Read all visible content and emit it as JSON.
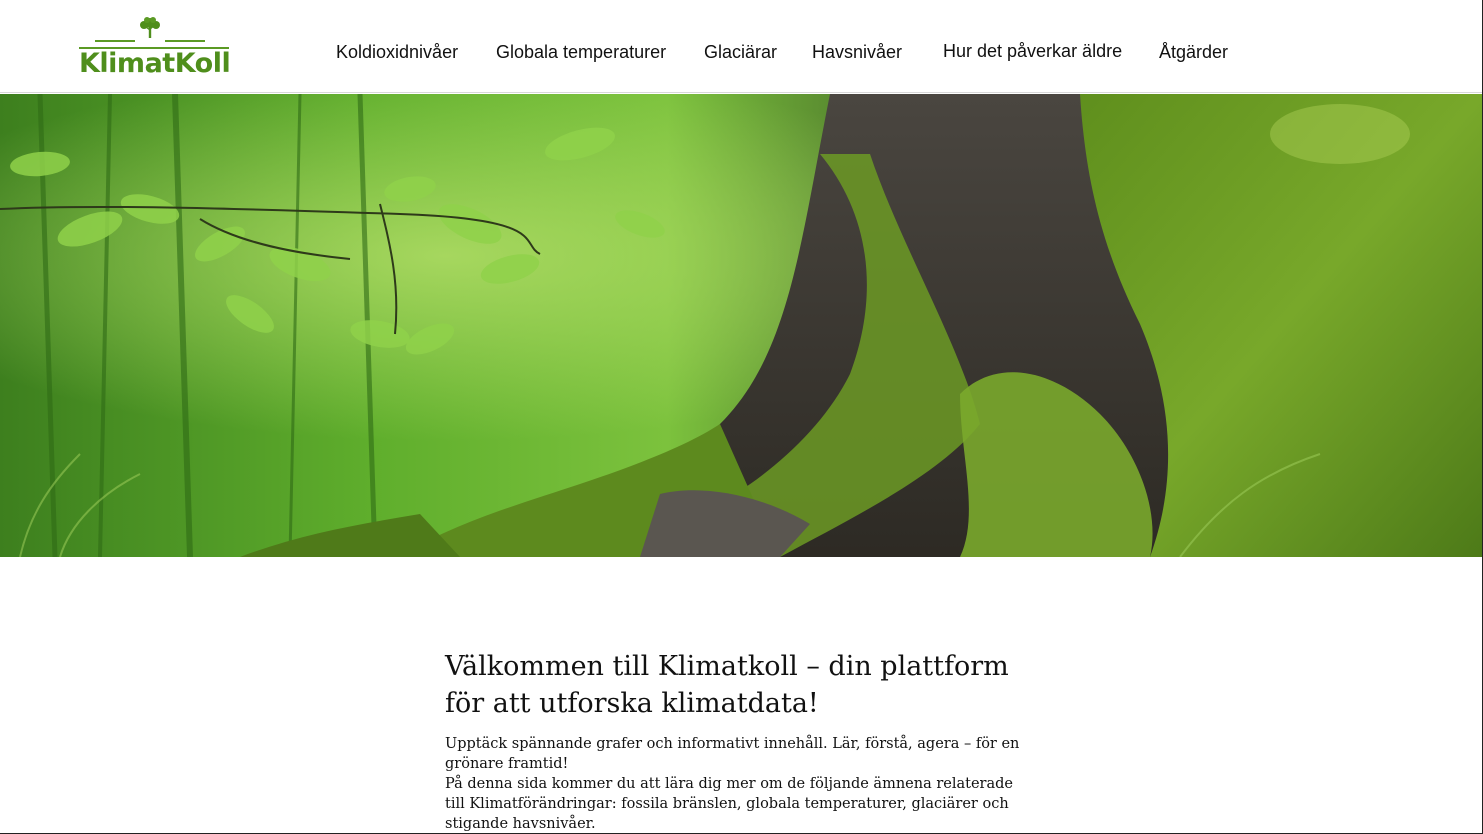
{
  "header": {
    "logo_text": "KlimatKoll",
    "nav": [
      {
        "label": "Koldioxidnivåer"
      },
      {
        "label": "Globala temperaturer"
      },
      {
        "label": "Glaciärar"
      },
      {
        "label": "Havsnivåer"
      },
      {
        "label": "Hur det påverkar äldre"
      },
      {
        "label": "Åtgärder"
      }
    ]
  },
  "hero": {
    "image": "mossy-tree-roots-forest"
  },
  "main": {
    "title": "Välkommen till Klimatkoll – din plattform för att utforska klimatdata!",
    "paragraph_1": "Upptäck spännande grafer och informativt innehåll. Lär, förstå, agera – för en grönare framtid!",
    "paragraph_2": "På denna sida kommer du att lära dig mer om de följande ämnena relaterade till Klimatförändringar: fossila bränslen, globala temperaturer, glaciärer och stigande havsnivåer."
  },
  "colors": {
    "brand_green": "#4f8e1c",
    "text": "#111111",
    "background": "#ffffff"
  }
}
